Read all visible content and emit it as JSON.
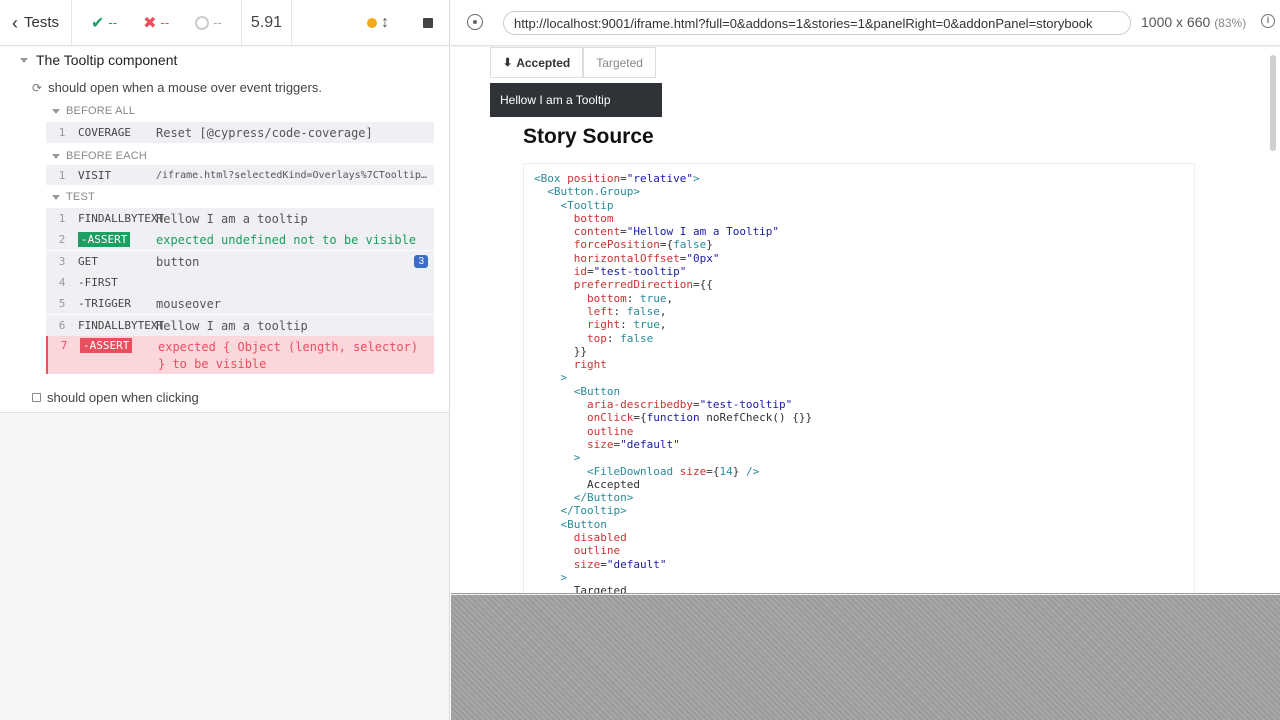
{
  "header": {
    "tests_label": "Tests",
    "passed": "--",
    "failed": "--",
    "pending": "--",
    "duration": "5.91"
  },
  "suite": {
    "title": "The Tooltip component",
    "test1_title": "should open when a mouse over event triggers.",
    "hooks": {
      "before_all": "BEFORE ALL",
      "before_each": "BEFORE EACH",
      "test": "TEST"
    },
    "commands": [
      {
        "num": "1",
        "name": "COVERAGE",
        "msg": "Reset [@cypress/code-coverage]"
      },
      {
        "num": "1",
        "name": "VISIT",
        "msg": "/iframe.html?selectedKind=Overlays%7CTooltip&selectedStory=..."
      },
      {
        "num": "1",
        "name": "FINDALLBYTEXT",
        "msg": "Hellow I am a tooltip"
      },
      {
        "num": "2",
        "name": "-ASSERT",
        "msg": "expected undefined not to be visible"
      },
      {
        "num": "3",
        "name": "GET",
        "msg": "button",
        "count": "3"
      },
      {
        "num": "4",
        "name": "-FIRST",
        "msg": ""
      },
      {
        "num": "5",
        "name": "-TRIGGER",
        "msg": "mouseover"
      },
      {
        "num": "6",
        "name": "FINDALLBYTEXT",
        "msg": "Hellow I am a tooltip"
      },
      {
        "num": "7",
        "name": "-ASSERT",
        "msg_line1": "expected { Object (length, selector)",
        "msg_line2": "} to be visible"
      }
    ],
    "test2_title": "should open when clicking"
  },
  "aut": {
    "url": "http://localhost:9001/iframe.html?full=0&addons=1&stories=1&panelRight=0&addonPanel=storybook",
    "viewport": "1000 x 660",
    "scale": "(83%)",
    "story": {
      "btn_accepted": "Accepted",
      "btn_targeted": "Targeted",
      "tooltip_text": "Hellow I am a Tooltip",
      "title": "Story Source"
    }
  }
}
